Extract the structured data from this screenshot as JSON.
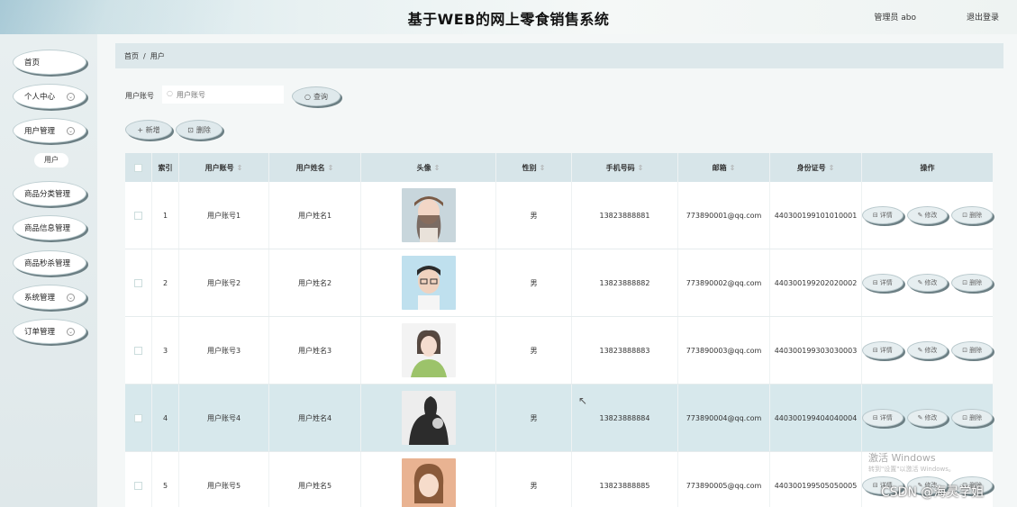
{
  "header": {
    "title": "基于WEB的网上零食销售系统",
    "user_label": "管理员 abo",
    "logout_label": "退出登录"
  },
  "sidebar": {
    "items": [
      {
        "label": "首页",
        "has_chevron": false
      },
      {
        "label": "个人中心",
        "has_chevron": true
      },
      {
        "label": "用户管理",
        "has_chevron": true
      },
      {
        "label": "商品分类管理",
        "has_chevron": false
      },
      {
        "label": "商品信息管理",
        "has_chevron": false
      },
      {
        "label": "商品秒杀管理",
        "has_chevron": false
      },
      {
        "label": "系统管理",
        "has_chevron": true
      },
      {
        "label": "订单管理",
        "has_chevron": true
      }
    ],
    "submenu_active": "用户"
  },
  "breadcrumb": {
    "home": "首页",
    "separator": "/",
    "current": "用户"
  },
  "search": {
    "label": "用户账号",
    "placeholder": "用户账号",
    "button_label": "查询"
  },
  "toolbar": {
    "add_label": "+ 新增",
    "delete_label": "删除"
  },
  "table": {
    "headers": {
      "index": "索引",
      "account": "用户账号",
      "name": "用户姓名",
      "avatar": "头像",
      "gender": "性别",
      "phone": "手机号码",
      "email": "邮箱",
      "id_number": "身份证号",
      "actions": "操作"
    },
    "rows": [
      {
        "index": "1",
        "account": "用户账号1",
        "name": "用户姓名1",
        "gender": "男",
        "phone": "13823888881",
        "email": "773890001@qq.com",
        "id_number": "440300199101010001",
        "avatar": "woman-cap"
      },
      {
        "index": "2",
        "account": "用户账号2",
        "name": "用户姓名2",
        "gender": "男",
        "phone": "13823888882",
        "email": "773890002@qq.com",
        "id_number": "440300199202020002",
        "avatar": "man-glasses"
      },
      {
        "index": "3",
        "account": "用户账号3",
        "name": "用户姓名3",
        "gender": "男",
        "phone": "13823888883",
        "email": "773890003@qq.com",
        "id_number": "440300199303030003",
        "avatar": "girl-green"
      },
      {
        "index": "4",
        "account": "用户账号4",
        "name": "用户姓名4",
        "gender": "男",
        "phone": "13823888884",
        "email": "773890004@qq.com",
        "id_number": "440300199404040004",
        "avatar": "man-dark"
      },
      {
        "index": "5",
        "account": "用户账号5",
        "name": "用户姓名5",
        "gender": "男",
        "phone": "13823888885",
        "email": "773890005@qq.com",
        "id_number": "440300199505050005",
        "avatar": "girl-smile"
      }
    ],
    "ops": {
      "detail": "详情",
      "edit": "修改",
      "delete": "删除"
    }
  },
  "watermark": {
    "windows": "激活 Windows",
    "windows_sub": "转到\"设置\"以激活 Windows。",
    "csdn": "CSDN @海灵学姐"
  },
  "colors": {
    "table_header_bg": "#d7e5e9",
    "row_highlight_bg": "#d7e8ec",
    "sidebar_bg": "#e8eff0",
    "button_bg": "#dfe9ec"
  }
}
